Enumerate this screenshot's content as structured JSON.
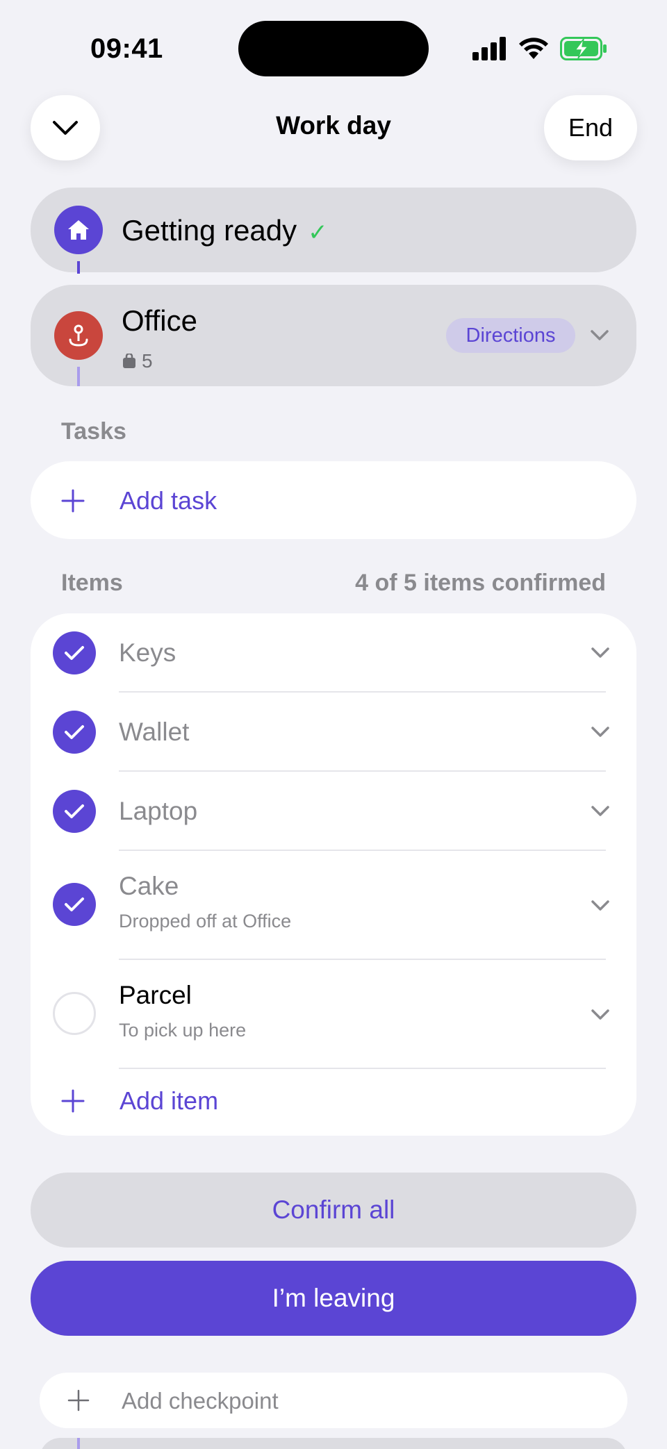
{
  "status_bar": {
    "time": "09:41",
    "icons": [
      "signal-icon",
      "wifi-icon",
      "battery-charging-icon"
    ],
    "battery_color": "#34c759"
  },
  "header": {
    "collapse_icon": "chevron-down-icon",
    "title": "Work day",
    "end_label": "End"
  },
  "checkpoints": [
    {
      "title": "Getting ready",
      "icon": "home-icon",
      "icon_color": "#5b45d4",
      "completed_mark": "✓"
    },
    {
      "title": "Office",
      "icon": "location-pin-icon",
      "icon_color": "#c9463d",
      "item_count": "5",
      "directions_label": "Directions"
    }
  ],
  "tasks": {
    "label": "Tasks",
    "add_label": "Add task"
  },
  "items": {
    "label": "Items",
    "summary": "4 of 5 items confirmed",
    "list": [
      {
        "name": "Keys",
        "subtitle": "",
        "confirmed": true
      },
      {
        "name": "Wallet",
        "subtitle": "",
        "confirmed": true
      },
      {
        "name": "Laptop",
        "subtitle": "",
        "confirmed": true
      },
      {
        "name": "Cake",
        "subtitle": "Dropped off at Office",
        "confirmed": true
      },
      {
        "name": "Parcel",
        "subtitle": "To pick up here",
        "confirmed": false
      }
    ],
    "add_label": "Add item"
  },
  "actions": {
    "confirm_all": "Confirm all",
    "leaving": "I’m leaving",
    "add_checkpoint": "Add checkpoint"
  },
  "colors": {
    "accent": "#5b45d4",
    "background": "#f2f2f7",
    "card": "#ffffff",
    "muted": "#8a8a8e"
  }
}
